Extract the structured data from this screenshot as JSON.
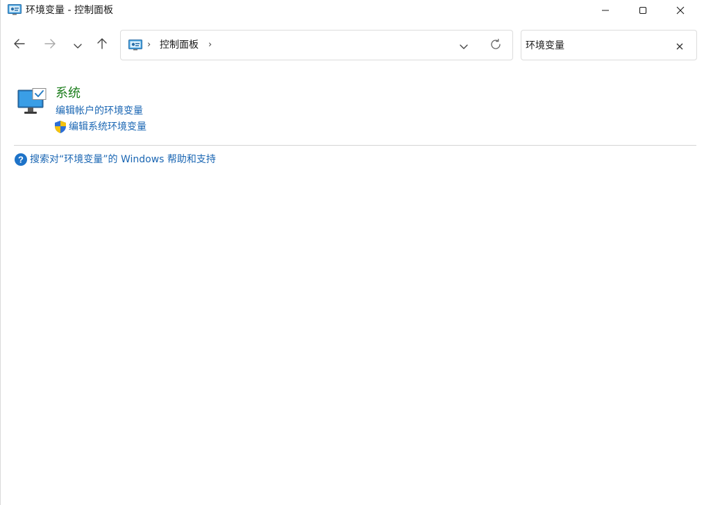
{
  "window": {
    "title": "环境变量 - 控制面板",
    "icon": "control-panel-icon"
  },
  "titlebar_buttons": {
    "minimize_icon": "minimize-icon",
    "maximize_icon": "maximize-icon",
    "close_icon": "close-icon"
  },
  "navigation": {
    "back_icon": "arrow-left-icon",
    "forward_icon": "arrow-right-icon",
    "recent_icon": "chevron-down-icon",
    "up_icon": "arrow-up-icon"
  },
  "address_bar": {
    "icon": "control-panel-icon",
    "separator": "›",
    "crumb": "控制面板",
    "trailing_separator": "›",
    "dropdown_icon": "chevron-down-icon",
    "refresh_icon": "refresh-icon"
  },
  "search": {
    "value": "环境变量",
    "clear_icon": "close-icon"
  },
  "results": {
    "category": {
      "title": "系统",
      "icon": "system-monitor-icon",
      "links": [
        {
          "label": "编辑帐户的环境变量",
          "icon": null
        },
        {
          "label": "编辑系统环境变量",
          "icon": "uac-shield-icon"
        }
      ]
    }
  },
  "help": {
    "label": "搜索对“环境变量”的 Windows 帮助和支持",
    "icon": "help-icon"
  },
  "colors": {
    "category_title": "#1b7d1b",
    "link": "#1a66b3",
    "divider": "#d4d4d4"
  }
}
